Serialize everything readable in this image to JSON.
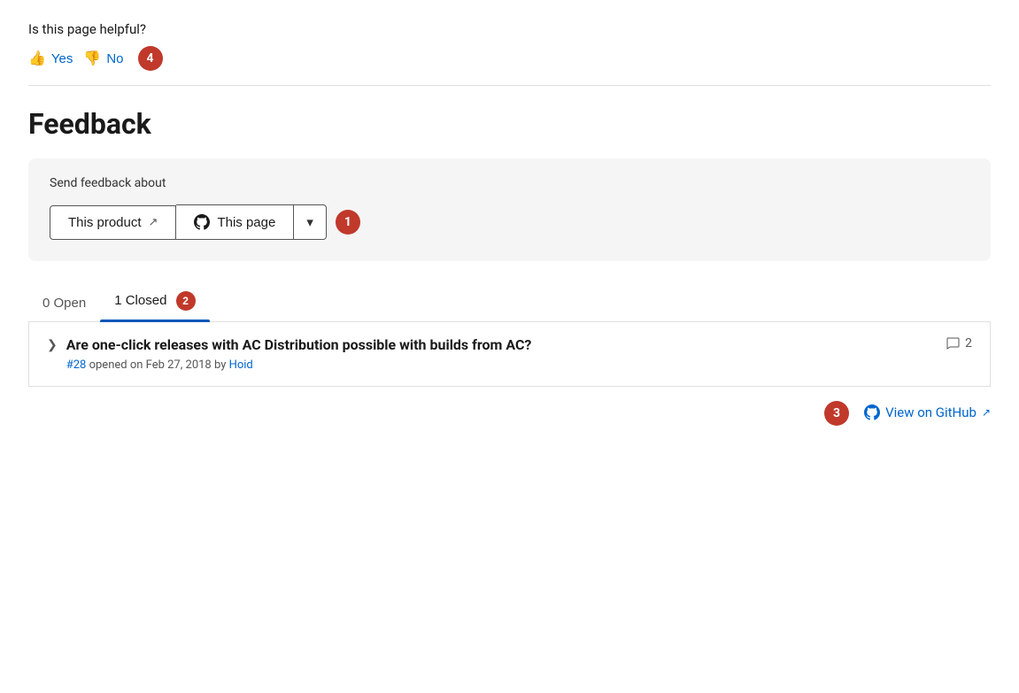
{
  "helpful": {
    "question": "Is this page helpful?",
    "yes_label": "Yes",
    "no_label": "No",
    "badge": "4"
  },
  "feedback": {
    "title": "Feedback",
    "send_label": "Send feedback about",
    "product_btn": "This product",
    "page_btn": "This page",
    "badge1": "1"
  },
  "tabs": {
    "open_label": "0 Open",
    "closed_label": "1 Closed",
    "badge2": "2"
  },
  "issue": {
    "title": "Are one-click releases with AC Distribution possible with builds from AC?",
    "number": "#28",
    "meta": "opened on Feb 27, 2018 by",
    "author": "Hoid",
    "comments": "2"
  },
  "github": {
    "link_label": "View on GitHub",
    "badge3": "3"
  }
}
